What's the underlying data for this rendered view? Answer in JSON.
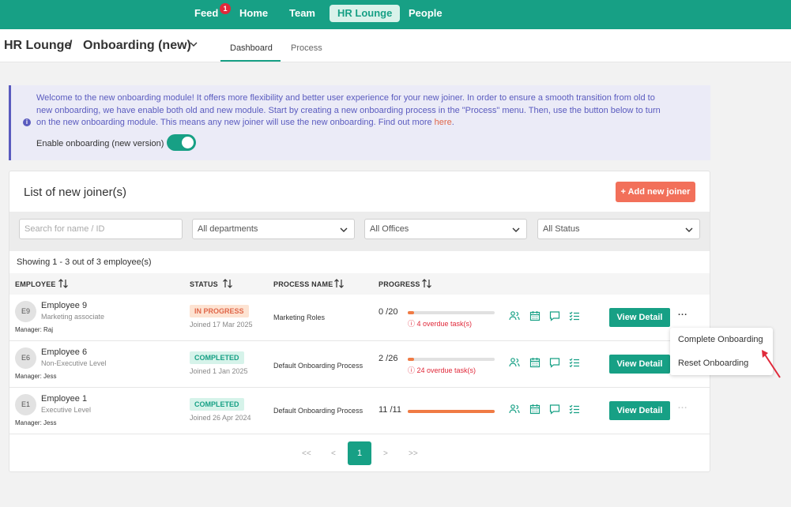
{
  "nav": {
    "items": [
      {
        "label": "Feed",
        "badge": "1"
      },
      {
        "label": "Home"
      },
      {
        "label": "Team"
      },
      {
        "label": "HR Lounge",
        "active": true
      },
      {
        "label": "People"
      }
    ]
  },
  "header": {
    "breadcrumb_root": "HR Lounge",
    "breadcrumb_sep": "/",
    "breadcrumb_current": "Onboarding (new)",
    "tabs": [
      "Dashboard",
      "Process"
    ]
  },
  "banner": {
    "text": "Welcome to the new onboarding module! It offers more flexibility and better user experience for your new joiner. In order to ensure a smooth transition from old to new onboarding, we have enable both old and new module. Start by creating a new onboarding process in the \"Process\" menu. Then, use the button below to turn on the new onboarding module. This means any new joiner will use the new onboarding. Find out more",
    "link": "here",
    "link_suffix": ".",
    "toggle_label": "Enable onboarding (new version)",
    "toggle_on": true
  },
  "card": {
    "title": "List of new joiner(s)",
    "add_button": "+ Add new joiner",
    "filters": {
      "search_placeholder": "Search for name / ID",
      "department": "All departments",
      "office": "All Offices",
      "status": "All Status"
    },
    "showing": "Showing 1 - 3 out of 3 employee(s)",
    "columns": [
      "EMPLOYEE",
      "STATUS",
      "PROCESS NAME",
      "PROGRESS"
    ],
    "rows": [
      {
        "initials": "E9",
        "name": "Employee 9",
        "role": "Marketing associate",
        "manager": "Manager: Raj",
        "status": "IN PROGRESS",
        "joined": "Joined 17 Mar 2025",
        "process": "Marketing Roles",
        "progress": "0 /20",
        "progress_fraction": 0,
        "overdue": "4 overdue task(s)",
        "view": "View Detail",
        "more": "..."
      },
      {
        "initials": "E6",
        "name": "Employee 6",
        "role": "Non-Executive Level",
        "manager": "Manager: Jess",
        "status": "COMPLETED",
        "joined": "Joined 1 Jan 2025",
        "process": "Default Onboarding Process",
        "progress": "2 /26",
        "progress_fraction": 0.0769,
        "overdue": "24 overdue task(s)",
        "view": "View Detail",
        "more": ""
      },
      {
        "initials": "E1",
        "name": "Employee 1",
        "role": "Executive Level",
        "manager": "Manager: Jess",
        "status": "COMPLETED",
        "joined": "Joined 26 Apr 2024",
        "process": "Default Onboarding Process",
        "progress": "11 /11",
        "progress_fraction": 1,
        "overdue": "",
        "view": "View Detail",
        "more": "..."
      }
    ],
    "pagination": {
      "first": "<<",
      "prev": "<",
      "current": "1",
      "next": ">",
      "last": ">>"
    }
  },
  "menu": {
    "items": [
      "Complete Onboarding",
      "Reset Onboarding"
    ]
  },
  "colors": {
    "brand": "#17a085",
    "accent": "#f2705a",
    "info": "#5a5bbf"
  }
}
